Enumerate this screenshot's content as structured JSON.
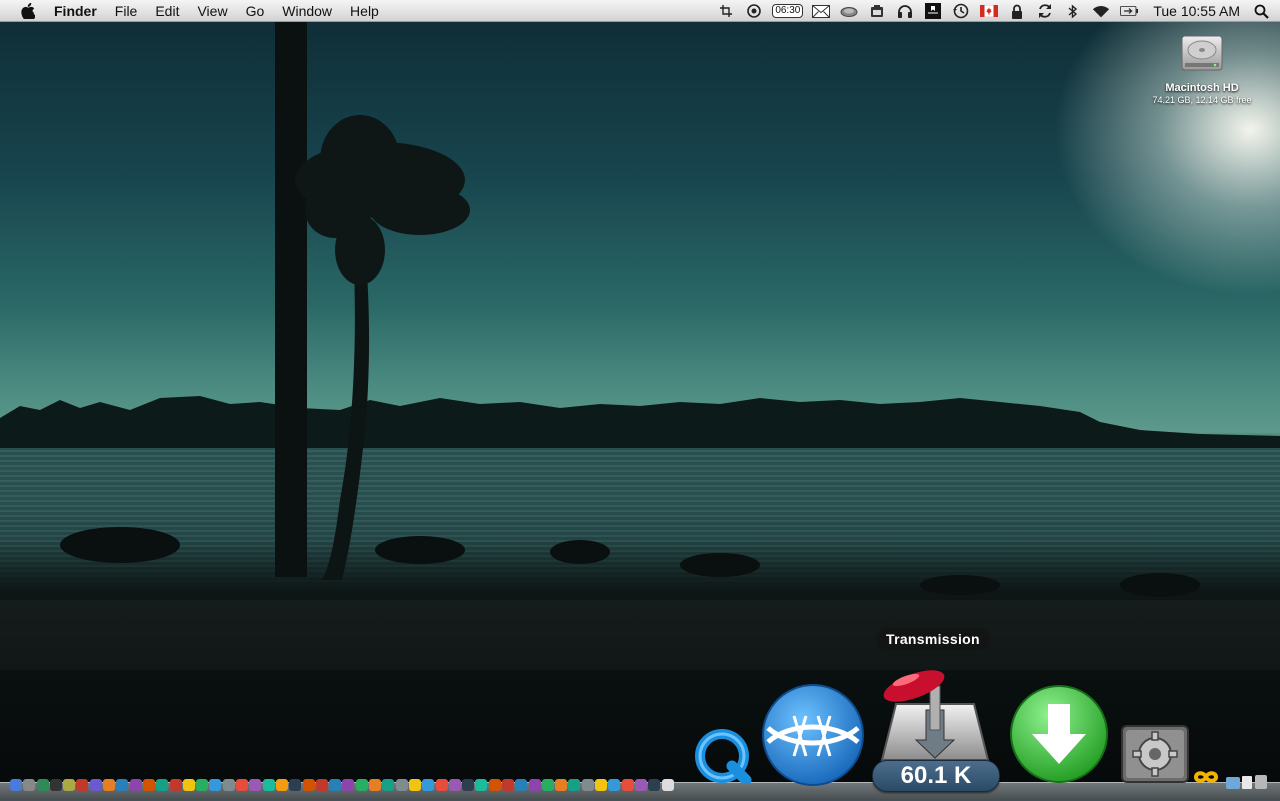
{
  "menubar": {
    "app_name": "Finder",
    "menus": [
      "File",
      "Edit",
      "View",
      "Go",
      "Window",
      "Help"
    ],
    "status_clock_badge": "06:30",
    "clock": "Tue 10:55 AM",
    "status_icons": [
      "crop-icon",
      "target-icon",
      "timer-badge",
      "mail-icon",
      "cloud-icon",
      "camera-icon",
      "headphones-icon",
      "bookmark-icon",
      "time-machine-icon",
      "canada-flag-icon",
      "lock-icon",
      "sync-icon",
      "bluetooth-icon",
      "wifi-icon",
      "battery-icon"
    ]
  },
  "desktop": {
    "drive": {
      "name": "Macintosh HD",
      "info": "74.21 GB, 12.14 GB free"
    }
  },
  "dock": {
    "tooltip": "Transmission",
    "transmission_badge": "60.1 K",
    "large_icons": [
      "quicktime-icon",
      "frostwire-icon",
      "transmission-icon",
      "download-arrow-icon",
      "system-preferences-icon"
    ]
  },
  "colors": {
    "menubar_top": "#f4f4f4",
    "sky": "#2a6866",
    "download_green": "#3cc23c",
    "frostwire_blue": "#2f8fd6"
  }
}
